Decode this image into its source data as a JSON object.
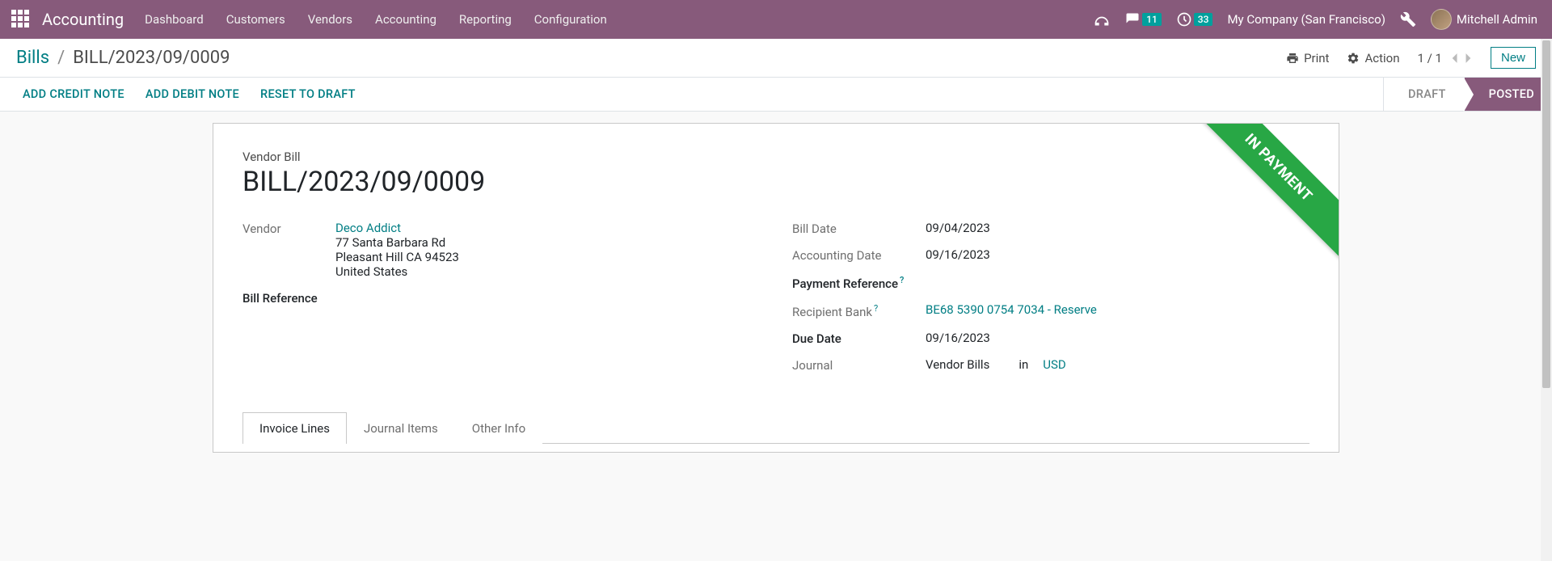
{
  "nav": {
    "brand": "Accounting",
    "items": [
      "Dashboard",
      "Customers",
      "Vendors",
      "Accounting",
      "Reporting",
      "Configuration"
    ]
  },
  "systray": {
    "messages_badge": "11",
    "activities_badge": "33",
    "company": "My Company (San Francisco)",
    "user": "Mitchell Admin"
  },
  "breadcrumb": {
    "parent": "Bills",
    "sep": "/",
    "current": "BILL/2023/09/0009"
  },
  "cp": {
    "print": "Print",
    "action": "Action",
    "pager": "1 / 1",
    "new": "New"
  },
  "status_actions": {
    "credit_note": "ADD CREDIT NOTE",
    "debit_note": "ADD DEBIT NOTE",
    "reset": "RESET TO DRAFT"
  },
  "status_steps": {
    "draft": "DRAFT",
    "posted": "POSTED"
  },
  "ribbon": "IN PAYMENT",
  "form": {
    "subtitle": "Vendor Bill",
    "title": "BILL/2023/09/0009",
    "left": {
      "vendor_label": "Vendor",
      "vendor_name": "Deco Addict",
      "vendor_addr1": "77 Santa Barbara Rd",
      "vendor_addr2": "Pleasant Hill CA 94523",
      "vendor_addr3": "United States",
      "bill_ref_label": "Bill Reference",
      "bill_ref_value": ""
    },
    "right": {
      "bill_date_label": "Bill Date",
      "bill_date_value": "09/04/2023",
      "acc_date_label": "Accounting Date",
      "acc_date_value": "09/16/2023",
      "pay_ref_label": "Payment Reference",
      "pay_ref_value": "",
      "bank_label": "Recipient Bank",
      "bank_value": "BE68 5390 0754 7034 - Reserve",
      "due_label": "Due Date",
      "due_value": "09/16/2023",
      "journal_label": "Journal",
      "journal_value": "Vendor Bills",
      "journal_in": "in",
      "journal_currency": "USD"
    }
  },
  "tabs": {
    "invoice_lines": "Invoice Lines",
    "journal_items": "Journal Items",
    "other_info": "Other Info"
  }
}
